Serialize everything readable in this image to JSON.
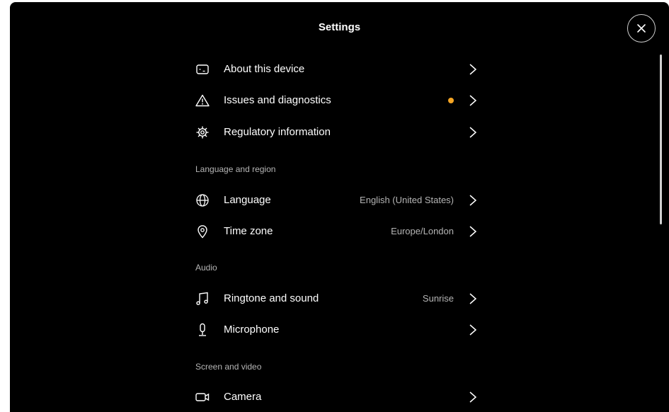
{
  "header": {
    "title": "Settings",
    "close_icon": "close-icon"
  },
  "items": {
    "about": {
      "label": "About this device",
      "icon": "device-icon"
    },
    "issues": {
      "label": "Issues and diagnostics",
      "icon": "warning-icon",
      "status_color": "#f5a524"
    },
    "regulatory": {
      "label": "Regulatory information",
      "icon": "gear-icon"
    },
    "language": {
      "label": "Language",
      "value": "English (United States)",
      "icon": "globe-icon"
    },
    "timezone": {
      "label": "Time zone",
      "value": "Europe/London",
      "icon": "location-pin-icon"
    },
    "ringtone": {
      "label": "Ringtone and sound",
      "value": "Sunrise",
      "icon": "music-note-icon"
    },
    "microphone": {
      "label": "Microphone",
      "icon": "microphone-icon"
    },
    "camera": {
      "label": "Camera",
      "icon": "camera-icon"
    }
  },
  "sections": {
    "language_region": "Language and region",
    "audio": "Audio",
    "screen_video": "Screen and video"
  }
}
